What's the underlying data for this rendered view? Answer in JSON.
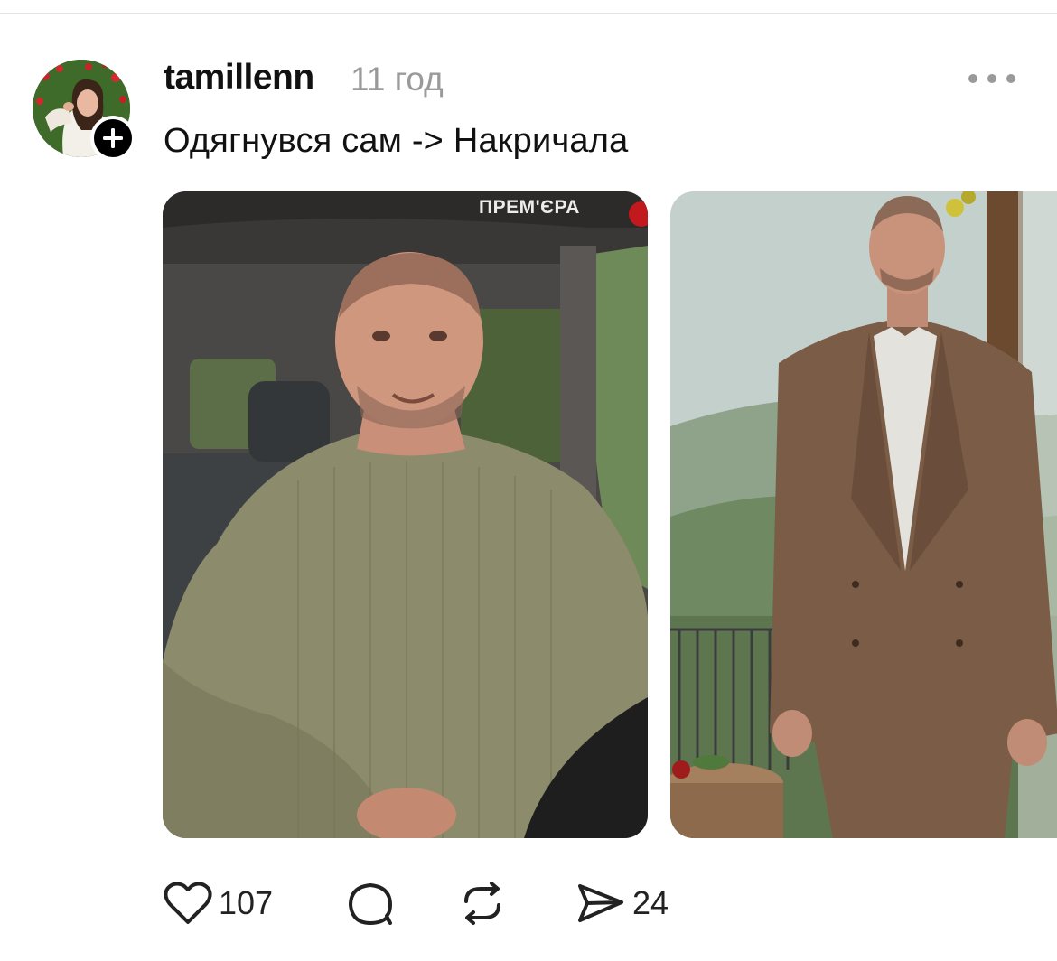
{
  "post": {
    "username": "tamillenn",
    "timestamp": "11 год",
    "text": "Одягнувся сам -> Накричала",
    "media": {
      "premiere_label": "ПРЕМ'ЄРА"
    }
  },
  "actions": {
    "likes": "107",
    "shares": "24"
  },
  "icons": {
    "avatar": "user-avatar",
    "follow": "plus-icon",
    "more": "more-dots-icon",
    "like": "heart-icon",
    "comment": "comment-icon",
    "repost": "repost-icon",
    "share": "send-icon"
  },
  "colors": {
    "timestamp": "#9a9a9a",
    "text": "#111111",
    "divider": "#e3e3e3"
  }
}
